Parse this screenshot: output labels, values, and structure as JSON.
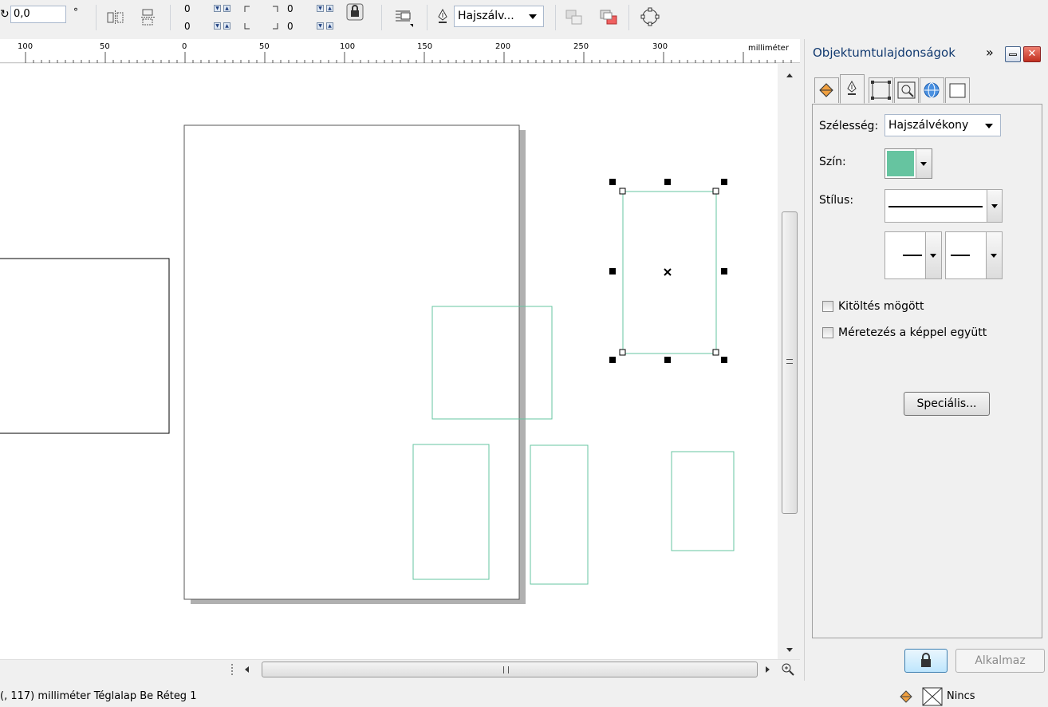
{
  "toolbar": {
    "rotation_value": "0,0",
    "degree_symbol": "°",
    "offset_top_left": "0",
    "offset_bottom_left": "0",
    "offset_top_right": "0",
    "offset_bottom_right": "0",
    "outline_width_label": "Hajszálv..."
  },
  "ruler": {
    "unit": "milliméter",
    "labels": [
      "100",
      "50",
      "0",
      "50",
      "100",
      "150",
      "200",
      "250",
      "300"
    ]
  },
  "docker": {
    "title": "Objektumtulajdonságok",
    "collapse_glyph": "»",
    "width_label": "Szélesség:",
    "width_value": "Hajszálvékony",
    "color_label": "Szín:",
    "color_value": "#66c4a0",
    "style_label": "Stílus:",
    "fill_behind_label": "Kitöltés mögött",
    "scale_with_image_label": "Méretezés a képpel együtt",
    "special_button": "Speciális...",
    "apply_button": "Alkalmaz"
  },
  "status": {
    "text": "(, 117)  milliméter Téglalap Be Réteg 1",
    "fill_label": "Nincs"
  },
  "colors": {
    "accent_outline": "#66c4a0",
    "title_blue": "#123a70"
  }
}
